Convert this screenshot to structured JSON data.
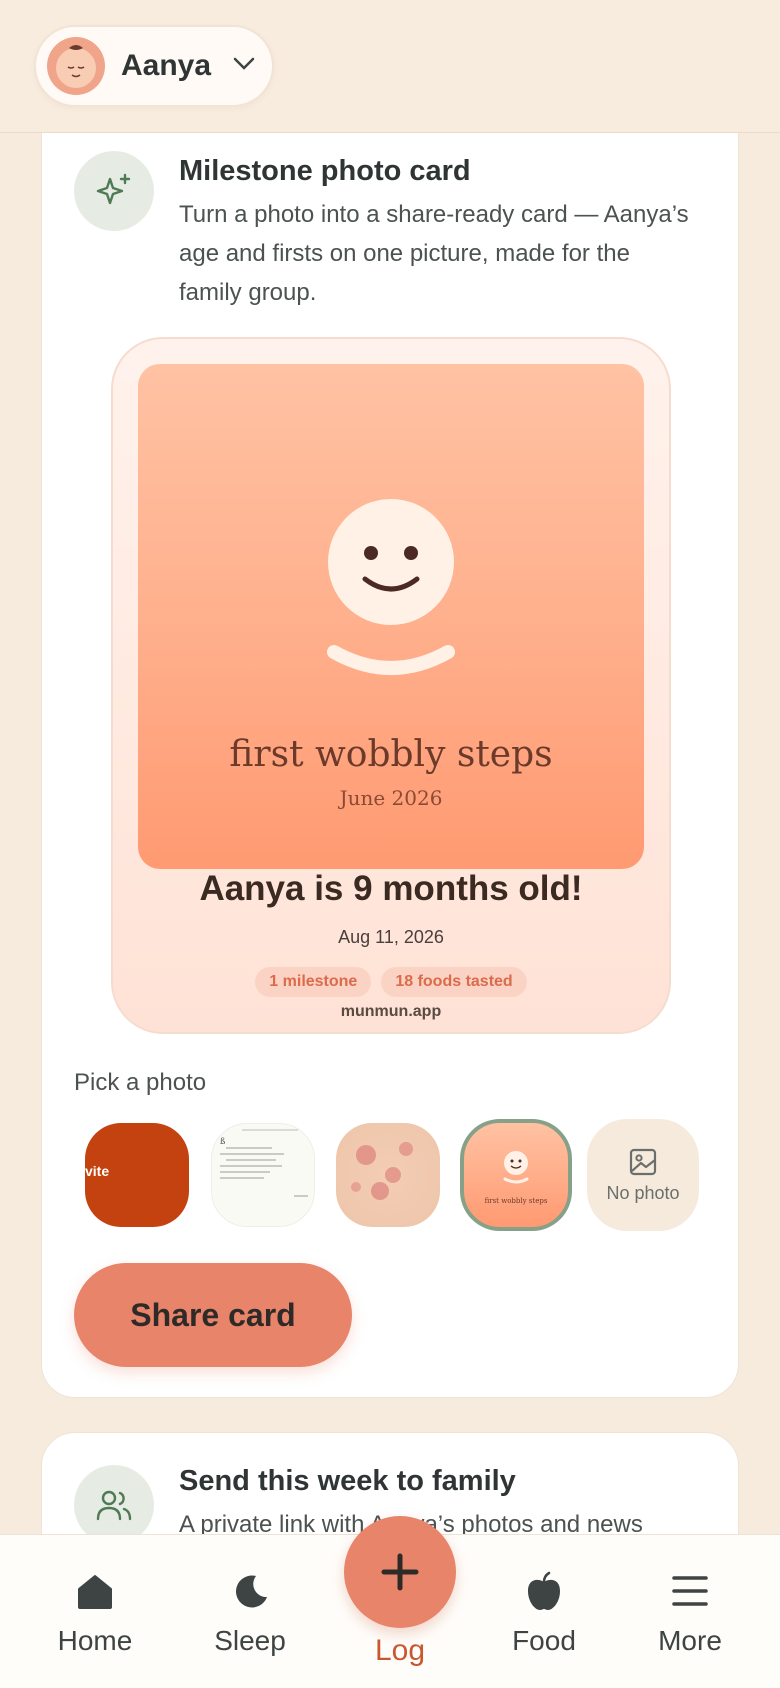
{
  "header": {
    "child_name": "Aanya"
  },
  "milestone_card": {
    "title": "Milestone photo card",
    "description": "Turn a photo into a share-ready card — Aanya’s age and firsts on one picture, made for the family group.",
    "preview": {
      "photo_title": "first wobbly steps",
      "photo_date": "June 2026",
      "age_line": "Aanya is 9 months old!",
      "date": "Aug 11, 2026",
      "chips": [
        "1 milestone",
        "18 foods tasted"
      ],
      "brand": "munmun.app"
    },
    "pick_label": "Pick a photo",
    "thumbnails": {
      "first_partial_text": "vite",
      "selected_caption": "first wobbly steps",
      "no_photo_label": "No photo"
    },
    "share_button": "Share card"
  },
  "family_card": {
    "title": "Send this week to family",
    "description": "A private link with Aanya’s photos and news"
  },
  "nav": {
    "home": "Home",
    "sleep": "Sleep",
    "log": "Log",
    "food": "Food",
    "more": "More"
  },
  "colors": {
    "accent": "#e8846a",
    "background": "#f6ebdd",
    "log_label": "#c9572f",
    "selected_border": "#86a188"
  }
}
